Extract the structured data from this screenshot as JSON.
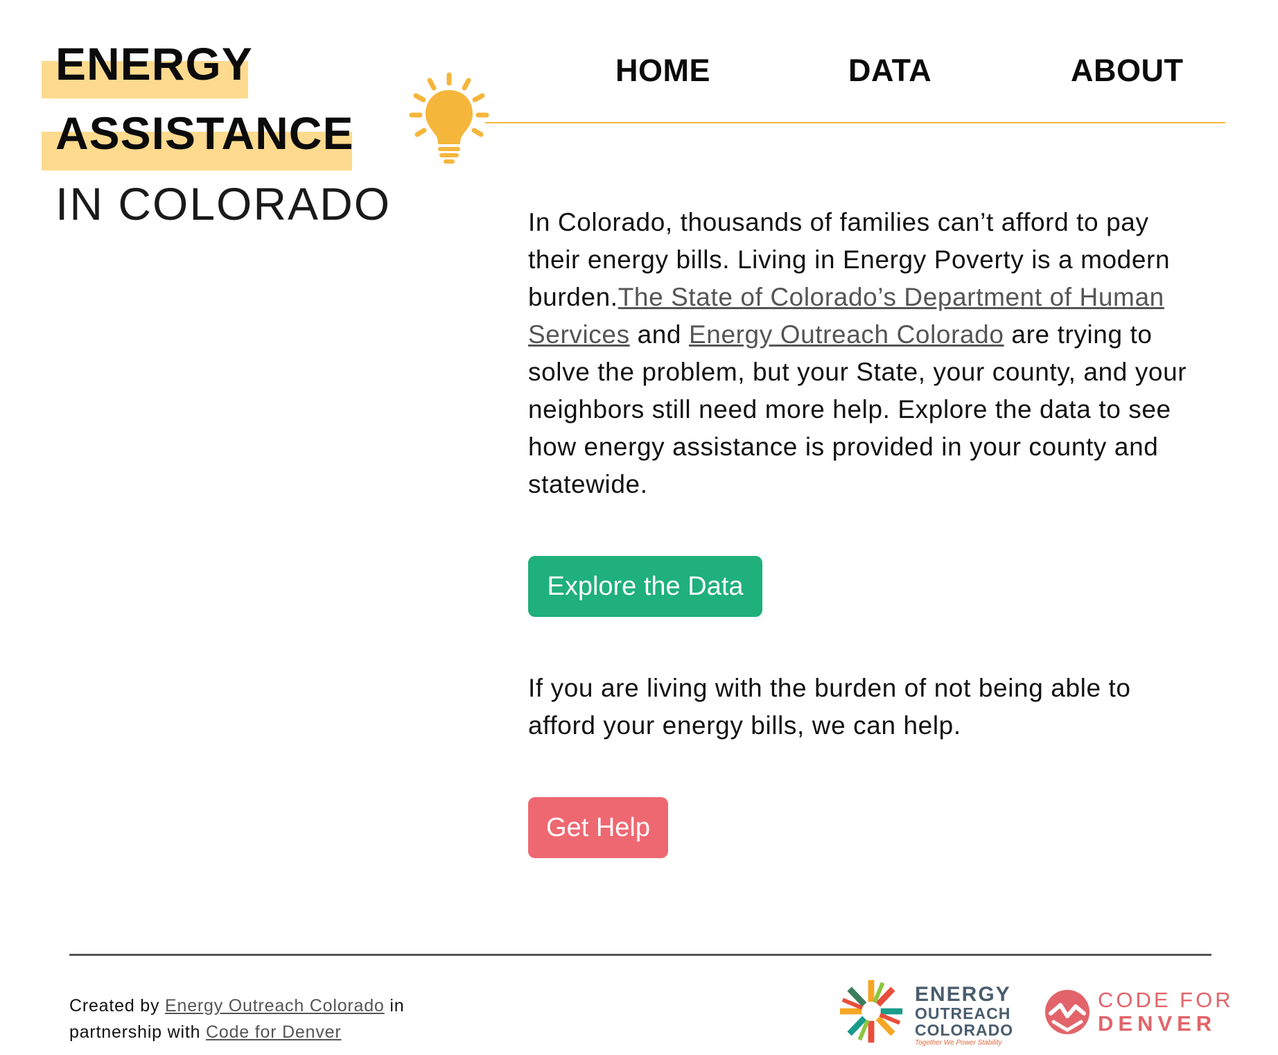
{
  "header": {
    "title_line1": "ENERGY",
    "title_line2": "ASSISTANCE",
    "title_line3": "IN COLORADO"
  },
  "nav": {
    "home": "HOME",
    "data": "DATA",
    "about": "ABOUT"
  },
  "colors": {
    "highlight": "#fdda8e",
    "accent_orange": "#f5b63c",
    "explore_button": "#1fb07b",
    "help_button": "#ee6872"
  },
  "main": {
    "intro_part1": "In Colorado, thousands of families can’t afford to pay their energy bills. Living in Energy Poverty is a modern burden.",
    "intro_link1": "The State of Colorado’s Department of Human Services",
    "intro_part2": " and ",
    "intro_link2": "Energy Outreach Colorado",
    "intro_part3": " are trying to solve the problem, but your State, your county, and your neighbors still need more help. Explore the data to see how energy assistance is provided in your county and statewide.",
    "explore_button": "Explore the Data",
    "help_text": "If you are living with the burden of not being able to afford your energy bills, we can help.",
    "help_button": "Get Help"
  },
  "footer": {
    "created_by": "Created by ",
    "eoc_link": "Energy Outreach Colorado",
    "in_partnership": " in partnership with ",
    "cfd_link": "Code for Denver",
    "eoc_logo_line1": "ENERGY",
    "eoc_logo_line2": "OUTREACH",
    "eoc_logo_line3": "COLORADO",
    "eoc_tagline": "Together We Power Stability",
    "cfd_logo_line1": "CODE FOR",
    "cfd_logo_line2": "DENVER"
  },
  "icons": {
    "bulb": "lightbulb-icon",
    "eoc": "energy-outreach-colorado-logo",
    "cfd": "code-for-denver-logo"
  }
}
